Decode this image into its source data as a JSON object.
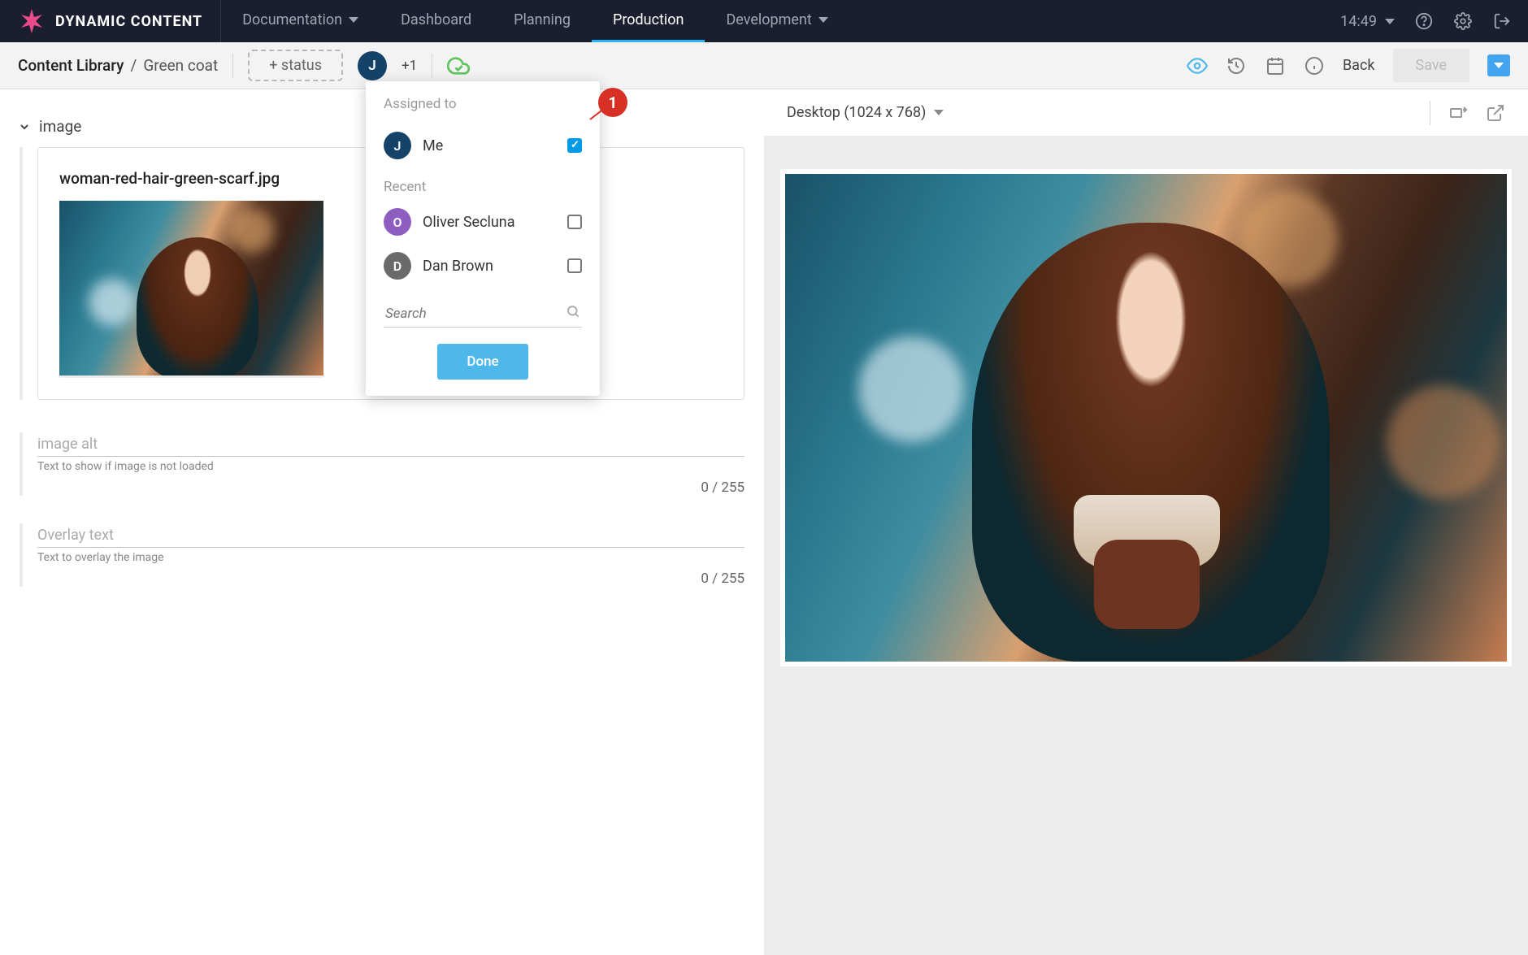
{
  "header": {
    "brand": "DYNAMIC CONTENT",
    "nav": [
      {
        "label": "Documentation",
        "dropdown": true
      },
      {
        "label": "Dashboard"
      },
      {
        "label": "Planning"
      },
      {
        "label": "Production",
        "active": true
      },
      {
        "label": "Development",
        "dropdown": true
      }
    ],
    "time": "14:49"
  },
  "subheader": {
    "breadcrumb_root": "Content Library",
    "breadcrumb_sep": "/",
    "breadcrumb_leaf": "Green coat",
    "status_chip": "+ status",
    "assignee_initial": "J",
    "assignee_more": "+1",
    "back": "Back",
    "save": "Save"
  },
  "popover": {
    "title": "Assigned to",
    "me_initial": "J",
    "me_label": "Me",
    "me_checked": true,
    "recent_title": "Recent",
    "recent": [
      {
        "initial": "O",
        "name": "Oliver Secluna",
        "checked": false,
        "avclass": "av-o"
      },
      {
        "initial": "D",
        "name": "Dan Brown",
        "checked": false,
        "avclass": "av-d"
      }
    ],
    "search_placeholder": "Search",
    "done": "Done"
  },
  "callout": {
    "num": "1"
  },
  "form": {
    "image_section": "image",
    "filename": "woman-red-hair-green-scarf.jpg",
    "alt_label": "image alt",
    "alt_hint": "Text to show if image is not loaded",
    "alt_counter": "0 / 255",
    "overlay_label": "Overlay text",
    "overlay_hint": "Text to overlay the image",
    "overlay_counter": "0 / 255"
  },
  "preview": {
    "device": "Desktop (1024 x 768)"
  }
}
